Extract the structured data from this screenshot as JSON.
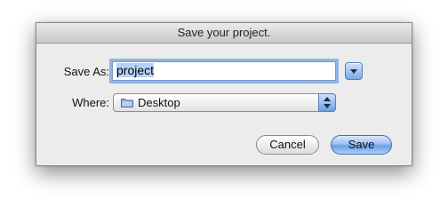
{
  "dialog": {
    "title": "Save your project.",
    "save_as_label": "Save As:",
    "save_as_value": "project",
    "where_label": "Where:",
    "where_value": "Desktop",
    "where_icon": "folder-icon",
    "disclosure_icon": "chevron-down-icon",
    "stepper_icon": "up-down-arrows-icon"
  },
  "buttons": {
    "cancel_label": "Cancel",
    "save_label": "Save"
  },
  "colors": {
    "accent_blue": "#6d9ee8",
    "focus_ring": "#8fb4e8",
    "dialog_bg": "#ececec"
  }
}
